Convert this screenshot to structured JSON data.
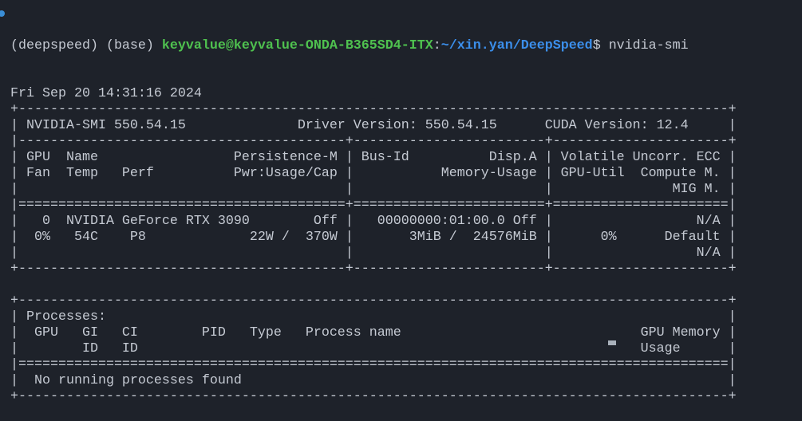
{
  "prompt": {
    "env": "(deepspeed) (base) ",
    "user_host": "keyvalue@keyvalue-ONDA-B365SD4-ITX",
    "sep": ":",
    "path": "~/xin.yan/DeepSpeed",
    "symbol": "$ ",
    "command": "nvidia-smi"
  },
  "output": [
    "Fri Sep 20 14:31:16 2024",
    "+-----------------------------------------------------------------------------------------+",
    "| NVIDIA-SMI 550.54.15              Driver Version: 550.54.15      CUDA Version: 12.4     |",
    "|-----------------------------------------+------------------------+----------------------+",
    "| GPU  Name                 Persistence-M | Bus-Id          Disp.A | Volatile Uncorr. ECC |",
    "| Fan  Temp   Perf          Pwr:Usage/Cap |           Memory-Usage | GPU-Util  Compute M. |",
    "|                                         |                        |               MIG M. |",
    "|=========================================+========================+======================|",
    "|   0  NVIDIA GeForce RTX 3090        Off |   00000000:01:00.0 Off |                  N/A |",
    "|  0%   54C    P8             22W /  370W |       3MiB /  24576MiB |      0%      Default |",
    "|                                         |                        |                  N/A |",
    "+-----------------------------------------+------------------------+----------------------+",
    "",
    "+-----------------------------------------------------------------------------------------+",
    "| Processes:                                                                              |",
    "|  GPU   GI   CI        PID   Type   Process name                              GPU Memory |",
    "|        ID   ID                                                               Usage      |",
    "|=========================================================================================|",
    "|  No running processes found                                                             |",
    "+-----------------------------------------------------------------------------------------+"
  ]
}
